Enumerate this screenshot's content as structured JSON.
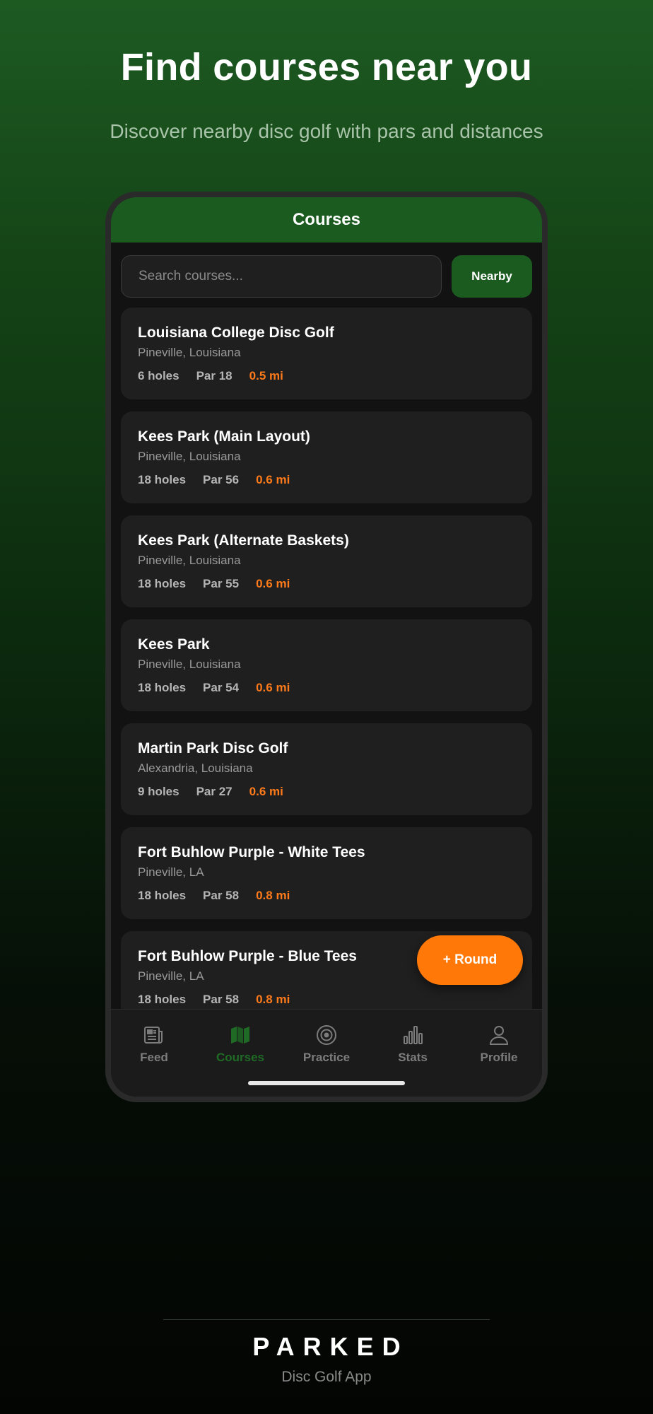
{
  "marketing": {
    "headline": "Find courses near you",
    "subhead": "Discover nearby disc golf with pars and distances"
  },
  "header": {
    "title": "Courses"
  },
  "search": {
    "placeholder": "Search courses...",
    "value": ""
  },
  "nearby_label": "Nearby",
  "courses": [
    {
      "name": "Louisiana College Disc Golf",
      "location": "Pineville, Louisiana",
      "holes": "6 holes",
      "par": "Par 18",
      "distance": "0.5 mi"
    },
    {
      "name": "Kees Park (Main Layout)",
      "location": "Pineville, Louisiana",
      "holes": "18 holes",
      "par": "Par 56",
      "distance": "0.6 mi"
    },
    {
      "name": "Kees Park (Alternate Baskets)",
      "location": "Pineville, Louisiana",
      "holes": "18 holes",
      "par": "Par 55",
      "distance": "0.6 mi"
    },
    {
      "name": "Kees Park",
      "location": "Pineville, Louisiana",
      "holes": "18 holes",
      "par": "Par 54",
      "distance": "0.6 mi"
    },
    {
      "name": "Martin Park Disc Golf",
      "location": "Alexandria, Louisiana",
      "holes": "9 holes",
      "par": "Par 27",
      "distance": "0.6 mi"
    },
    {
      "name": "Fort Buhlow Purple - White Tees",
      "location": "Pineville, LA",
      "holes": "18 holes",
      "par": "Par 58",
      "distance": "0.8 mi"
    },
    {
      "name": "Fort Buhlow Purple - Blue Tees",
      "location": "Pineville, LA",
      "holes": "18 holes",
      "par": "Par 58",
      "distance": "0.8 mi"
    }
  ],
  "fab_label": "+ Round",
  "tabs": [
    {
      "label": "Feed",
      "icon": "newspaper-icon",
      "active": false
    },
    {
      "label": "Courses",
      "icon": "map-icon",
      "active": true
    },
    {
      "label": "Practice",
      "icon": "target-icon",
      "active": false
    },
    {
      "label": "Stats",
      "icon": "bar-chart-icon",
      "active": false
    },
    {
      "label": "Profile",
      "icon": "user-icon",
      "active": false
    }
  ],
  "colors": {
    "accent_green": "#1c5b20",
    "distance_orange": "#ff7a1a",
    "fab_orange": "#ff7808",
    "active_tab": "#1f6b25",
    "inactive_tab": "#7c7c7c"
  },
  "brand": {
    "name": "PARKED",
    "tagline": "Disc Golf App"
  }
}
